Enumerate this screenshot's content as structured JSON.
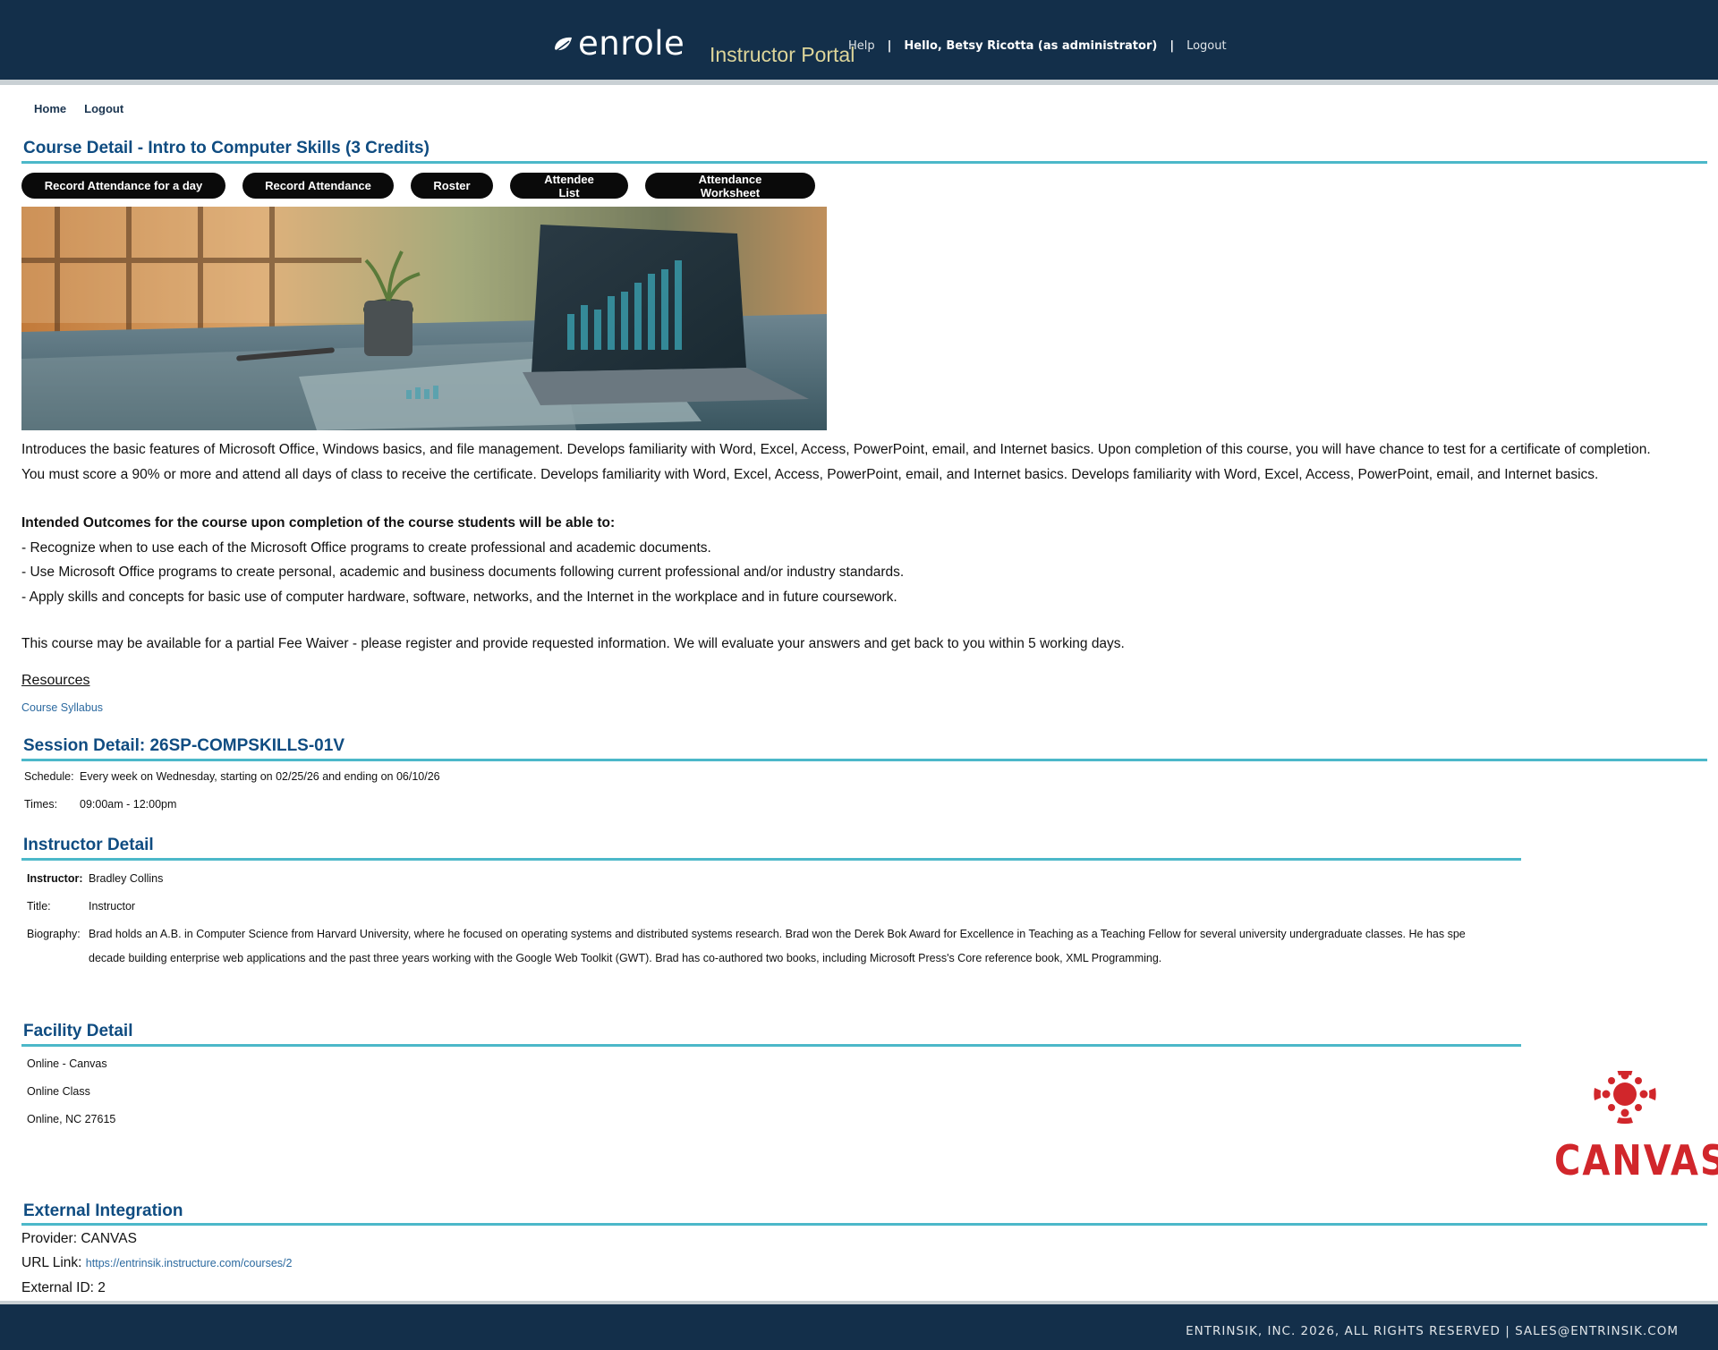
{
  "header": {
    "logo_text": "enrole",
    "portal_title": "Instructor Portal",
    "help_label": "Help",
    "separator": "|",
    "hello_text": "Hello,  Betsy Ricotta (as administrator)",
    "logout_label": "Logout",
    "bg_color": "#132f4a",
    "title_color": "#ddd59a"
  },
  "subnav": {
    "home_label": "Home",
    "logout_label": "Logout"
  },
  "course": {
    "title": "Course Detail - Intro to Computer Skills (3 Credits)",
    "buttons": [
      "Record Attendance for a day",
      "Record Attendance",
      "Roster",
      "Attendee List",
      "Attendance Worksheet"
    ],
    "description_1": "Introduces the basic features of Microsoft Office, Windows basics, and file management. Develops familiarity with Word, Excel, Access, PowerPoint, email, and Internet basics. Upon completion of this course, you will have chance to test for a certificate of completion.",
    "description_2": "You must score a 90% or more and attend all days of class to receive the certificate. Develops familiarity with Word, Excel, Access, PowerPoint, email, and Internet basics. Develops familiarity with Word, Excel, Access, PowerPoint, email, and Internet basics.",
    "outcomes_heading": "Intended Outcomes for the course upon completion of the course students will be able to:",
    "outcome_1": "- Recognize when to use each of the Microsoft Office programs to create professional and academic documents.",
    "outcome_2": "- Use Microsoft Office programs to create personal, academic and business documents following current professional and/or industry standards.",
    "outcome_3": "- Apply skills and concepts for basic use of computer hardware, software, networks, and the Internet in the workplace and in future coursework.",
    "fee_waiver": "This course may be available for a partial Fee Waiver - please register and provide requested information. We will evaluate your answers and get back to you within 5 working days.",
    "resources_label": "Resources",
    "syllabus_link": "Course Syllabus"
  },
  "session": {
    "title": "Session Detail: 26SP-COMPSKILLS-01V",
    "schedule_label": "Schedule:",
    "schedule_value": "Every week on Wednesday, starting on 02/25/26 and ending on 06/10/26",
    "times_label": "Times:",
    "times_value": "09:00am - 12:00pm"
  },
  "instructor": {
    "title": "Instructor Detail",
    "instructor_label": "Instructor:",
    "instructor_value": "Bradley Collins",
    "title_label": "Title:",
    "title_value": "Instructor",
    "bio_label": "Biography:",
    "bio_line_1": "Brad holds an A.B. in Computer Science from Harvard University, where he focused on operating systems and distributed systems research. Brad won the Derek Bok Award for Excellence in Teaching as a Teaching Fellow for several university undergraduate classes. He has spe",
    "bio_line_2": "decade building enterprise web applications and the past three years working with the Google Web Toolkit (GWT). Brad has co-authored two books, including Microsoft Press's Core reference book, XML Programming."
  },
  "facility": {
    "title": "Facility Detail",
    "line_1": "Online - Canvas",
    "line_2": "Online Class",
    "line_3": "Online, NC 27615",
    "logo_text": "CANVAS",
    "logo_color": "#d1262b"
  },
  "external": {
    "title": "External Integration",
    "provider_text": "Provider: CANVAS",
    "url_label": "URL Link:",
    "url_value": "https://entrinsik.instructure.com/courses/2",
    "external_id_text": "External ID: 2"
  },
  "footer": {
    "text": "ENTRINSIK, INC. 2026, ALL RIGHTS RESERVED  |  SALES@ENTRINSIK.COM"
  }
}
